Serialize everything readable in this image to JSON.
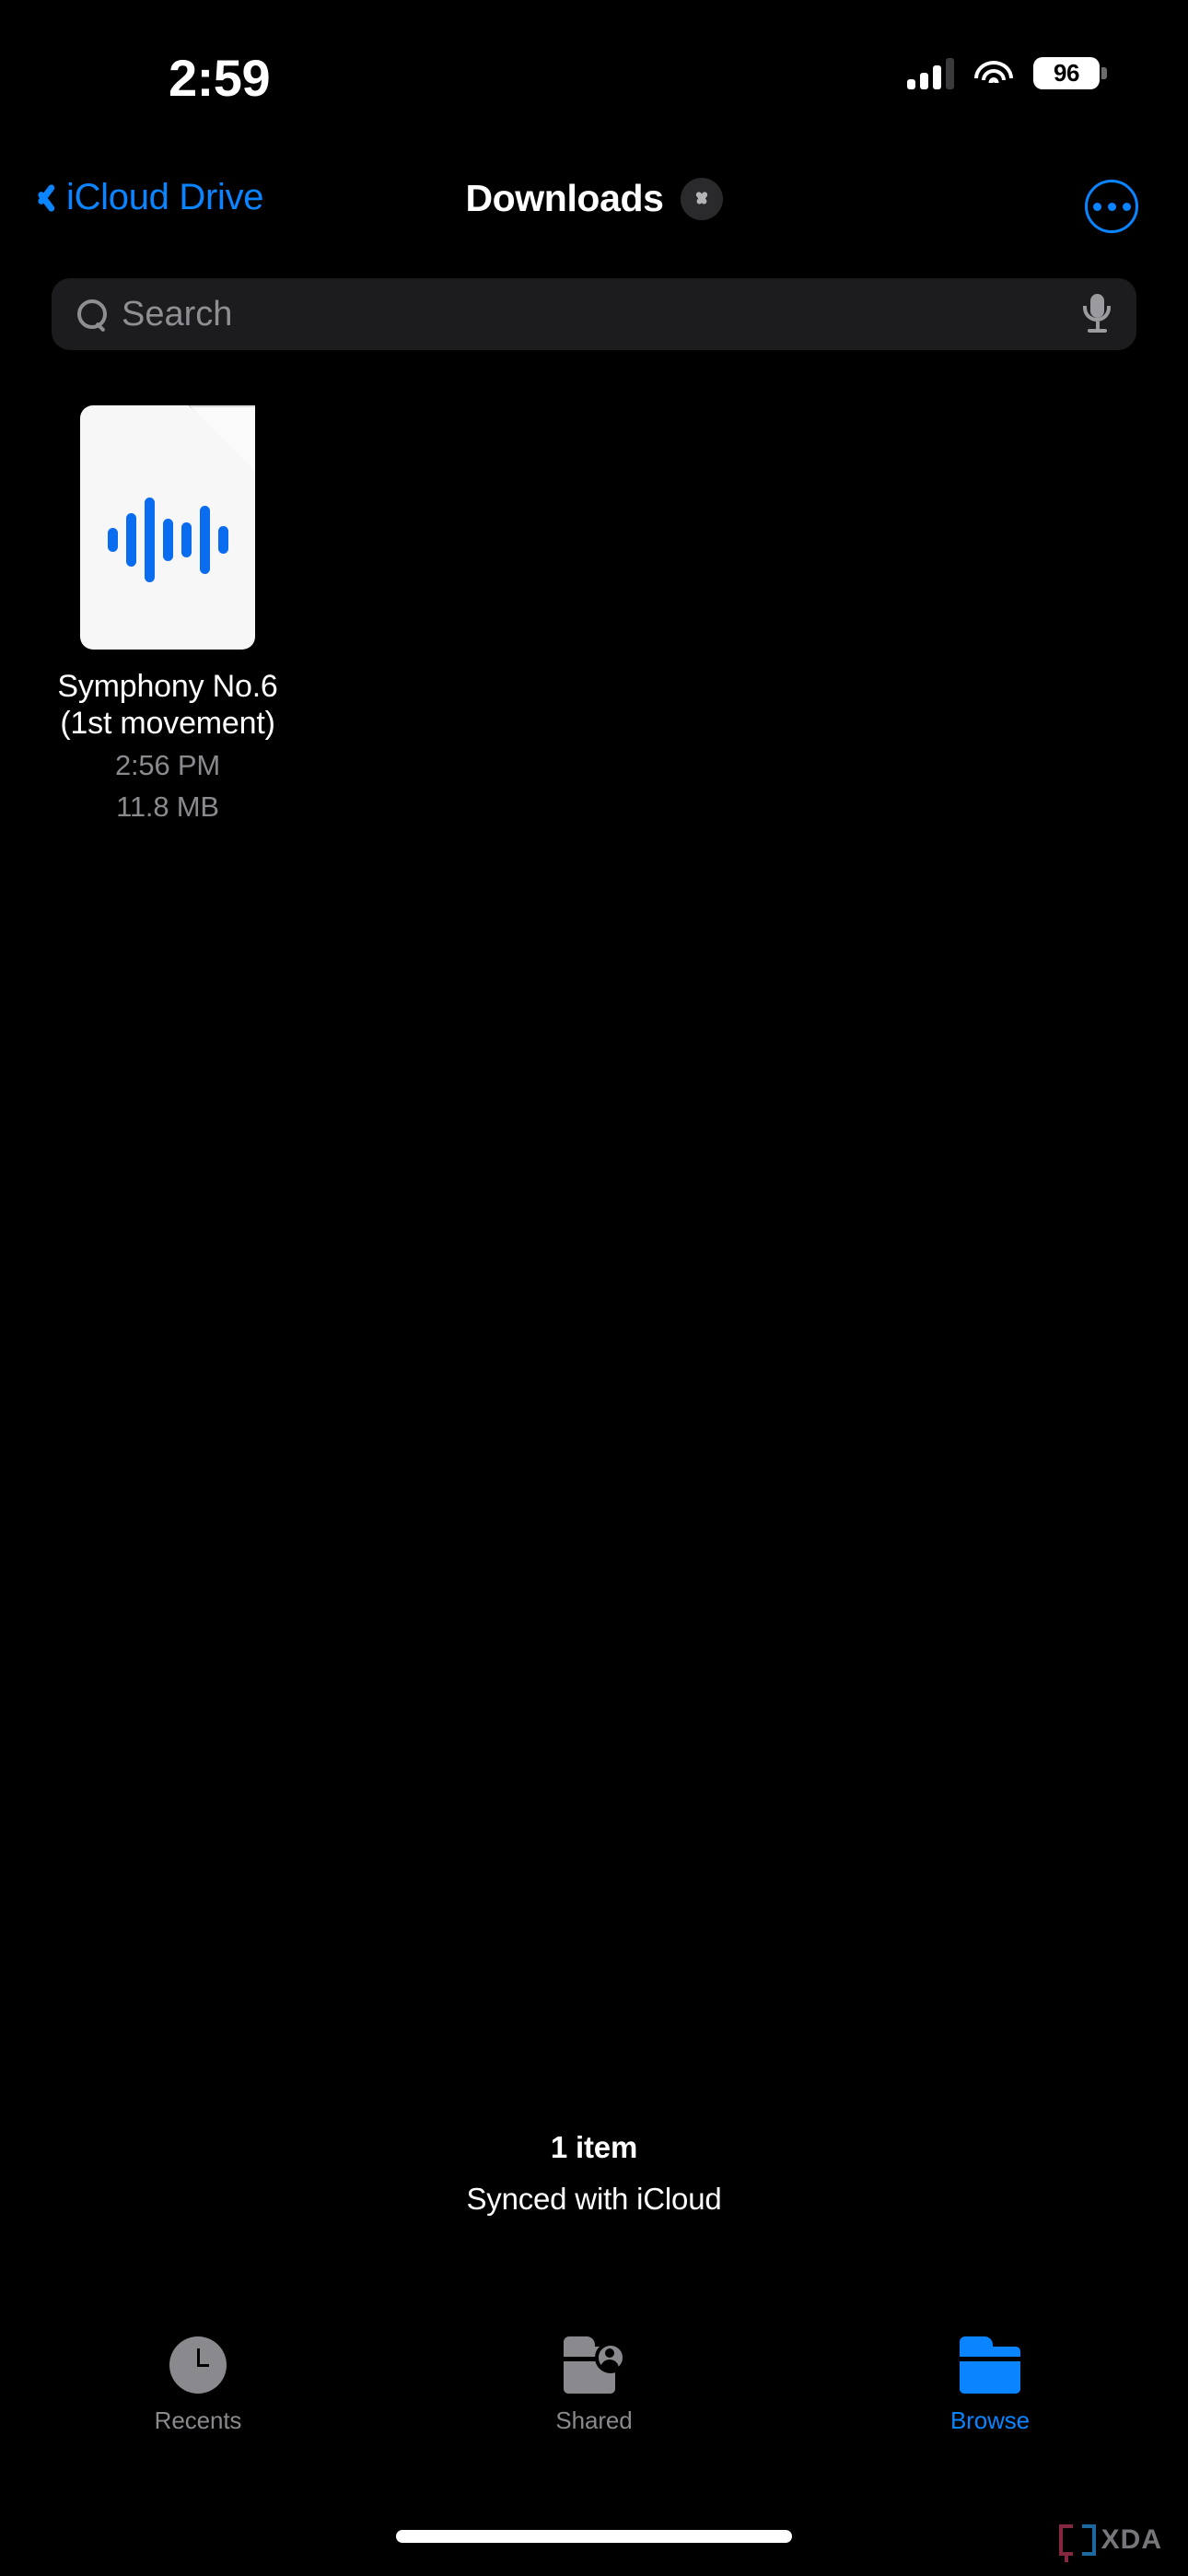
{
  "status_bar": {
    "time": "2:59",
    "battery_level": "96",
    "signal_bars_filled": 3,
    "signal_bars_total": 4,
    "wifi_icon": "wifi-icon",
    "battery_icon": "battery-icon"
  },
  "nav_bar": {
    "back_label": "iCloud Drive",
    "back_icon": "chevron-left-icon",
    "title": "Downloads",
    "disclosure_icon": "chevron-down-icon",
    "more_icon": "ellipsis-circle-icon"
  },
  "search": {
    "placeholder": "Search",
    "value": "",
    "search_icon": "search-icon",
    "dictation_icon": "microphone-icon"
  },
  "files": [
    {
      "name_line1": "Symphony No.6",
      "name_line2": "(1st movement)",
      "time": "2:56 PM",
      "size": "11.8 MB",
      "icon": "audio-document-icon",
      "waveform_bar_heights": [
        26,
        58,
        92,
        46,
        38,
        74,
        30
      ]
    }
  ],
  "footer": {
    "item_count": "1 item",
    "sync_status": "Synced with iCloud"
  },
  "tab_bar": {
    "tabs": [
      {
        "label": "Recents",
        "icon": "clock-icon",
        "active": false
      },
      {
        "label": "Shared",
        "icon": "shared-folder-icon",
        "active": false
      },
      {
        "label": "Browse",
        "icon": "folder-icon",
        "active": true
      }
    ]
  },
  "watermark": {
    "text": "XDA"
  },
  "colors": {
    "background": "#000000",
    "accent_blue": "#0A84FF",
    "waveform_blue": "#0A6CEF",
    "secondary_text": "#8A8A8E",
    "search_field": "#1C1C1E",
    "disclosure_circle": "#2A2A2C"
  }
}
